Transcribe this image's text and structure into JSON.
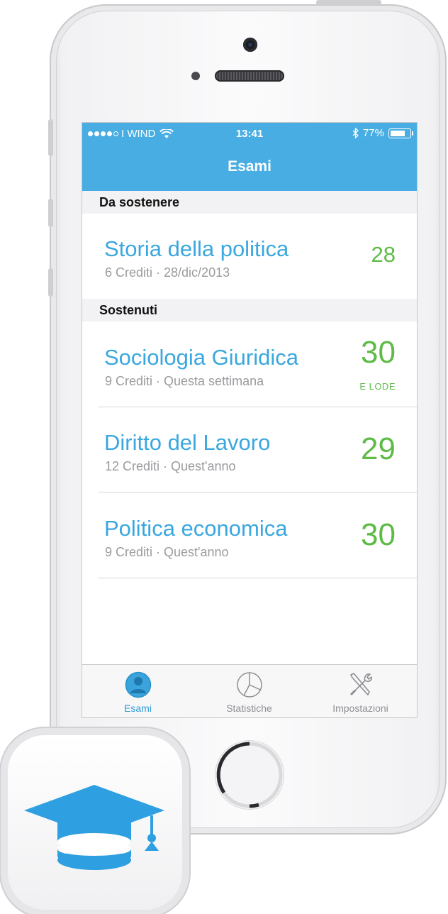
{
  "status_bar": {
    "carrier": "I WIND",
    "time": "13:41",
    "battery": "77%",
    "battery_level": 0.77
  },
  "navbar": {
    "title": "Esami"
  },
  "sections": [
    {
      "header": "Da sostenere",
      "rows": [
        {
          "title": "Storia della politica",
          "subtitle": "6 Crediti · 28/dic/2013",
          "grade": "28",
          "note": ""
        }
      ]
    },
    {
      "header": "Sostenuti",
      "rows": [
        {
          "title": "Sociologia Giuridica",
          "subtitle": "9 Crediti · Questa settimana",
          "grade": "30",
          "note": "E LODE"
        },
        {
          "title": "Diritto del Lavoro",
          "subtitle": "12 Crediti · Quest'anno",
          "grade": "29",
          "note": ""
        },
        {
          "title": "Politica economica",
          "subtitle": "9 Crediti · Quest'anno",
          "grade": "30",
          "note": ""
        }
      ]
    }
  ],
  "tabbar": [
    {
      "label": "Esami",
      "icon": "user-icon",
      "active": true
    },
    {
      "label": "Statistiche",
      "icon": "pie-chart-icon",
      "active": false
    },
    {
      "label": "Impostazioni",
      "icon": "tools-icon",
      "active": false
    }
  ],
  "colors": {
    "accent": "#47ade2",
    "grade_green": "#5dbb46",
    "title_blue": "#3aa7de"
  },
  "app_icon": {
    "icon": "graduation-cap-icon"
  }
}
